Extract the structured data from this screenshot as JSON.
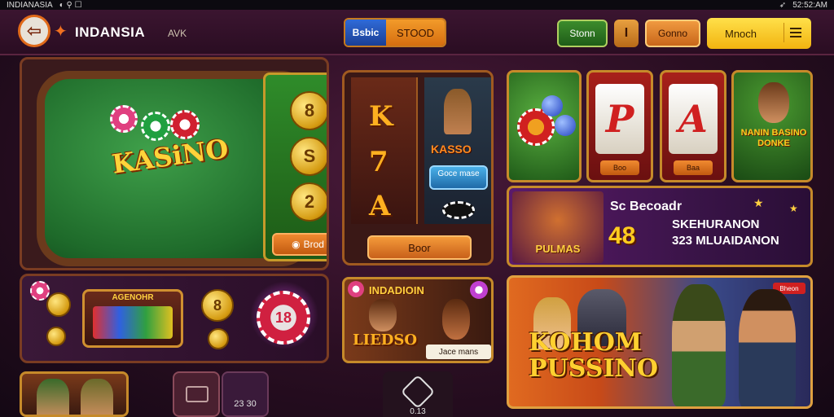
{
  "statusbar": {
    "left": "INDIANASIA",
    "right": "52:52:AM"
  },
  "header": {
    "brand": "INDANSIA",
    "brand_sub": "AVK",
    "pill_a": "Bsbic",
    "pill_b": "STOOD",
    "btn_green": "Stonn",
    "btn_mini": "I",
    "btn_orange": "Gonno",
    "btn_yellow": "Mnoch"
  },
  "table_panel": {
    "title": "KASiNO",
    "coins": [
      "8",
      "S",
      "2"
    ],
    "coin_button": "Brod"
  },
  "slot_panel": {
    "reel_symbols": [
      "K",
      "7",
      "A"
    ],
    "character_title": "KASSO",
    "character_button": "Goce mase",
    "button": "Boor"
  },
  "reel_tiles": [
    {
      "symbol": "P",
      "button": "Boo"
    },
    {
      "symbol": "A",
      "button": "Baa"
    }
  ],
  "char_tile": {
    "label": "NANIN BASINO DONKE"
  },
  "purple_banner": {
    "portrait_label": "PULMAS",
    "line1": "Sc Becoadr",
    "big": "48",
    "line2": "SKEHURANON",
    "line3": "323 MLUAIDANON"
  },
  "bottom_left": {
    "machine_title": "AGENOHR",
    "coin_8": "8",
    "chip": "18"
  },
  "game_banner": {
    "title": "INDADIOIN",
    "sub": "LIEDSO",
    "tag": "Jace mans"
  },
  "hero_banner": {
    "badge": "Bheon",
    "title_line1": "KOHOM",
    "title_line2": "PUSSINO"
  },
  "bottom_tabs": {
    "tab_b": "23 30",
    "center_label": "0.13"
  }
}
